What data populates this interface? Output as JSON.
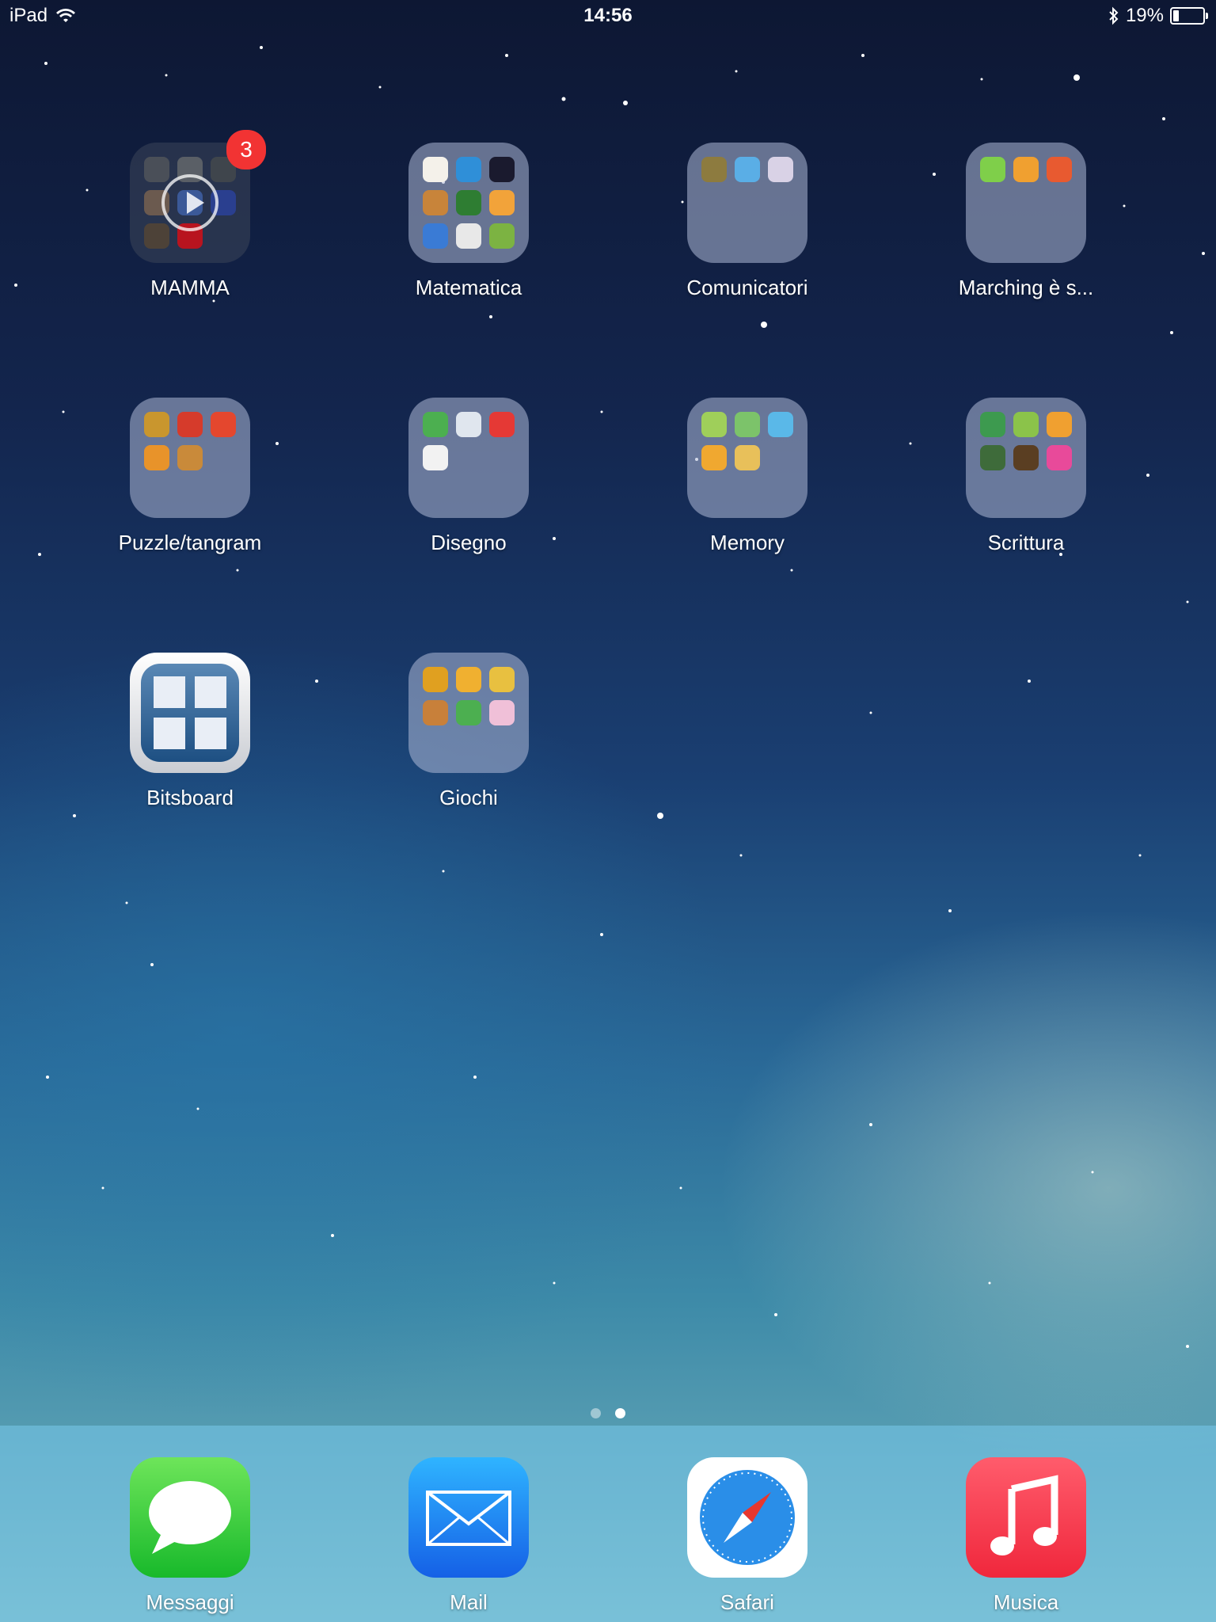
{
  "status": {
    "device": "iPad",
    "time": "14:56",
    "battery": "19%",
    "battery_level": 0.19
  },
  "folders": [
    {
      "label": "MAMMA",
      "badge": "3"
    },
    {
      "label": "Matematica"
    },
    {
      "label": "Comunicatori"
    },
    {
      "label": "Marching è s..."
    },
    {
      "label": "Puzzle/tangram"
    },
    {
      "label": "Disegno"
    },
    {
      "label": "Memory"
    },
    {
      "label": "Scrittura"
    },
    {
      "label": "Giochi"
    }
  ],
  "apps": {
    "bitsboard": "Bitsboard"
  },
  "dock": [
    {
      "label": "Messaggi",
      "icon": "speech-bubble-icon"
    },
    {
      "label": "Mail",
      "icon": "envelope-icon"
    },
    {
      "label": "Safari",
      "icon": "compass-icon"
    },
    {
      "label": "Musica",
      "icon": "music-note-icon"
    }
  ],
  "page_dots": {
    "count": 2,
    "active": 2
  }
}
